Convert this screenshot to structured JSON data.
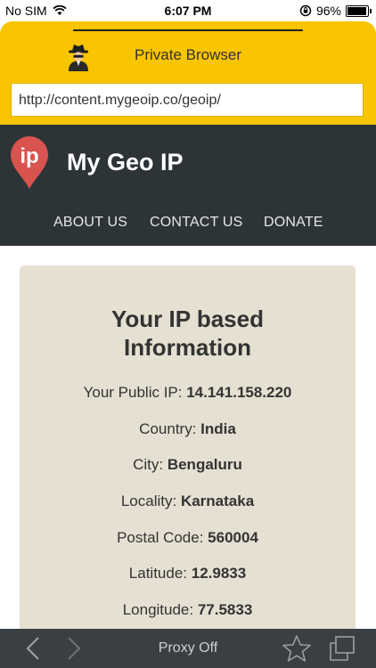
{
  "status_bar": {
    "carrier": "No SIM",
    "time": "6:07 PM",
    "battery_percent": "96%",
    "battery_level": 0.96
  },
  "browser": {
    "title": "Private Browser",
    "url": "http://content.mygeoip.co/geoip/",
    "accent_color": "#f9c400"
  },
  "site": {
    "logo_text": "ip",
    "title": "My Geo IP",
    "nav": [
      "ABOUT US",
      "CONTACT US",
      "DONATE"
    ],
    "header_color": "#2d3438",
    "logo_color": "#d9534f"
  },
  "card": {
    "heading_line1": "Your IP based",
    "heading_line2": "Information",
    "rows": [
      {
        "label": "Your Public IP:",
        "value": "14.141.158.220"
      },
      {
        "label": "Country:",
        "value": "India"
      },
      {
        "label": "City:",
        "value": "Bengaluru"
      },
      {
        "label": "Locality:",
        "value": "Karnataka"
      },
      {
        "label": "Postal Code:",
        "value": "560004"
      },
      {
        "label": "Latitude:",
        "value": "12.9833"
      },
      {
        "label": "Longitude:",
        "value": "77.5833"
      }
    ]
  },
  "toolbar": {
    "proxy_status": "Proxy Off"
  },
  "icons": {
    "wifi": "wifi-icon",
    "lock_rotation": "orientation-lock-icon",
    "battery": "battery-icon",
    "spy": "spy-icon",
    "back": "back-arrow-icon",
    "forward": "forward-arrow-icon",
    "bookmark": "star-icon",
    "tabs": "tabs-icon"
  }
}
